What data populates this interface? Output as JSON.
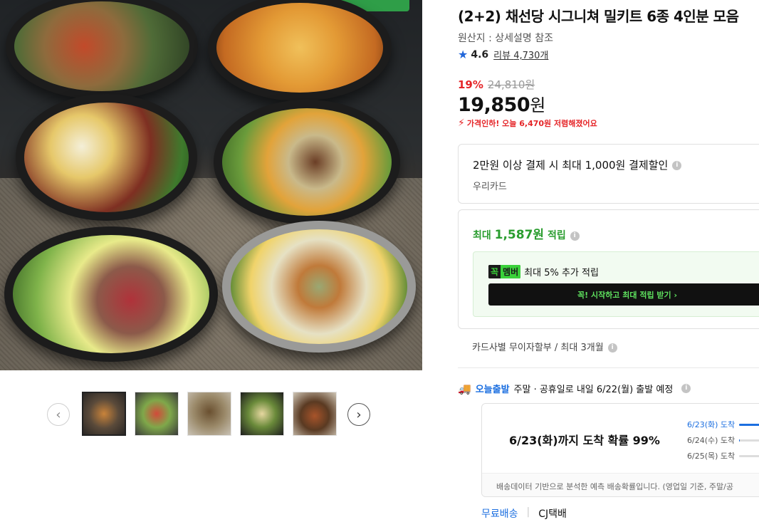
{
  "product": {
    "title": "(2+2) 채선당 시그니쳐 밀키트 6종 4인분 모음",
    "origin": "원산지 : 상세설명 참조",
    "rating": {
      "score": "4.6",
      "review_label": "리뷰",
      "review_count": "4,730개"
    }
  },
  "price": {
    "discount_rate": "19%",
    "original_price": "24,810원",
    "sale_price": "19,850",
    "unit": "원",
    "drop_notice": "가격인하! 오늘 6,470원 저렴해졌어요"
  },
  "card_benefit": {
    "headline": "2만원 이상 결제 시 최대 1,000원 결제할인",
    "card": "우리카드"
  },
  "rewards": {
    "prefix": "최대",
    "amount": "1,587원",
    "suffix": "적립",
    "member_logo_a": "꼭",
    "member_logo_b": "멤버",
    "member_text": "최대 5% 추가 적립",
    "member_cta": "꼭! 시작하고 최대 적립 받기 ›"
  },
  "installment": "카드사별 무이자할부 / 최대 3개월",
  "shipping": {
    "badge": "오늘출발",
    "notice": "주말 · 공휴일로 내일 6/22(월) 출발 예정",
    "arrival_headline": "6/23(화)까지 도착 확률 99%",
    "arrival_options": [
      {
        "label": "6/23(화) 도착",
        "fill": 0.99
      },
      {
        "label": "6/24(수) 도착",
        "fill": 0.01
      },
      {
        "label": "6/25(목) 도착",
        "fill": 0.0
      }
    ],
    "arrival_note": "배송데이터 기반으로 분석한 예측 배송확률입니다. (영업일 기준, 주말/공",
    "free_shipping": "무료배송",
    "carrier": "CJ택배"
  },
  "gallery": {
    "thumbnail_count": 5,
    "active_index": 0
  },
  "colors": {
    "accent_blue": "#1c6fe0",
    "discount_red": "#e52528",
    "reward_green": "#2a9d2f"
  }
}
